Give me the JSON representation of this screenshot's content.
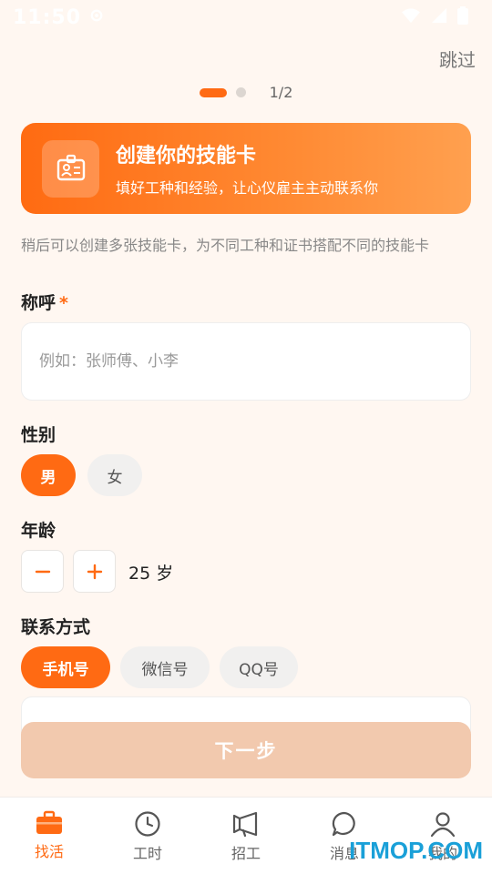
{
  "status_bar": {
    "time": "11:50"
  },
  "header": {
    "skip_label": "跳过",
    "progress_text": "1/2"
  },
  "banner": {
    "title": "创建你的技能卡",
    "subtitle": "填好工种和经验，让心仪雇主主动联系你"
  },
  "hint": "稍后可以创建多张技能卡，为不同工种和证书搭配不同的技能卡",
  "name_field": {
    "label": "称呼",
    "required_mark": "*",
    "placeholder": "例如：张师傅、小李",
    "value": ""
  },
  "gender": {
    "label": "性别",
    "options": [
      {
        "label": "男",
        "selected": true
      },
      {
        "label": "女",
        "selected": false
      }
    ]
  },
  "age": {
    "label": "年龄",
    "value": "25 岁",
    "minus": "−",
    "plus": "+"
  },
  "contact": {
    "label": "联系方式",
    "options": [
      {
        "label": "手机号",
        "selected": true
      },
      {
        "label": "微信号",
        "selected": false
      },
      {
        "label": "QQ号",
        "selected": false
      }
    ]
  },
  "next_button": {
    "label": "下一步"
  },
  "bottom_nav": {
    "items": [
      {
        "label": "找活",
        "icon": "briefcase-icon",
        "active": true
      },
      {
        "label": "工时",
        "icon": "clock-icon",
        "active": false
      },
      {
        "label": "招工",
        "icon": "megaphone-icon",
        "active": false
      },
      {
        "label": "消息",
        "icon": "chat-icon",
        "active": false
      },
      {
        "label": "我的",
        "icon": "user-icon",
        "active": false
      }
    ]
  },
  "watermark": "ITMOP.COM",
  "colors": {
    "accent": "#ff6a13",
    "background": "#fff7f1",
    "disabled_button": "#f2c9ae"
  }
}
